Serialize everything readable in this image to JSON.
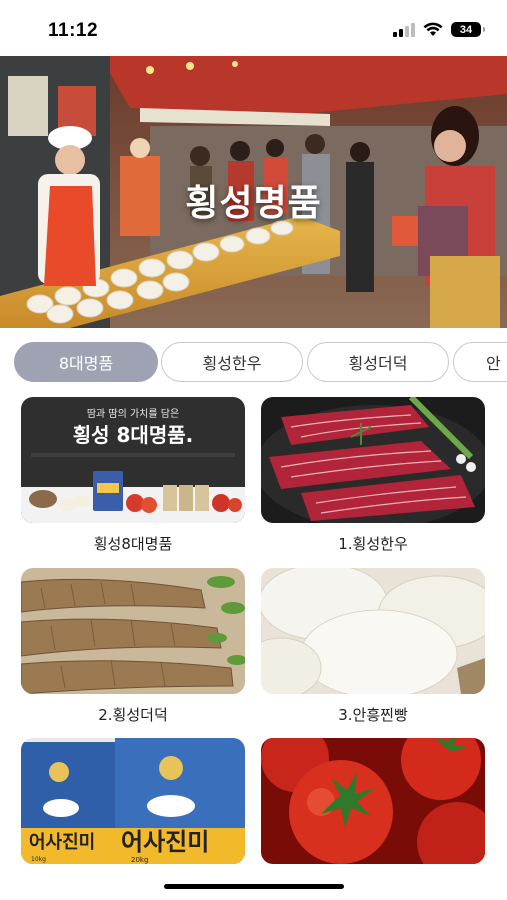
{
  "status_bar": {
    "time": "11:12",
    "battery": "34"
  },
  "hero": {
    "title": "횡성명품"
  },
  "tabs": [
    {
      "label": "8대명품",
      "active": true
    },
    {
      "label": "횡성한우",
      "active": false
    },
    {
      "label": "횡성더덕",
      "active": false
    },
    {
      "label": "안",
      "active": false
    }
  ],
  "promo_banner": {
    "subtitle": "땀과 땀의 가치를 담은",
    "title": "횡성 8대명품."
  },
  "rice_bag": {
    "brand": "어사진미",
    "weight_small": "10kg",
    "weight_large": "20kg"
  },
  "products": [
    {
      "label": "횡성8대명품",
      "icon": "promo-banner-image"
    },
    {
      "label": "1.횡성한우",
      "icon": "beef-image"
    },
    {
      "label": "2.횡성더덕",
      "icon": "deodeok-root-image"
    },
    {
      "label": "3.안흥찐빵",
      "icon": "steamed-bun-image"
    },
    {
      "label": "",
      "icon": "rice-bag-image"
    },
    {
      "label": "",
      "icon": "tomato-image"
    }
  ],
  "colors": {
    "active_tab": "#9ea2b3",
    "tab_border": "#c9c9c9"
  }
}
